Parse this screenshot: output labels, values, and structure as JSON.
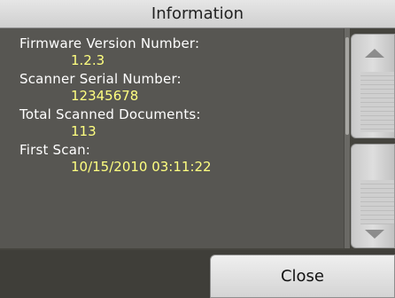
{
  "title": "Information",
  "fields": [
    {
      "label": "Firmware Version Number:",
      "value": "1.2.3"
    },
    {
      "label": "Scanner Serial Number:",
      "value": "12345678"
    },
    {
      "label": "Total Scanned Documents:",
      "value": "113"
    },
    {
      "label": "First Scan:",
      "value": "10/15/2010 03:11:22"
    }
  ],
  "buttons": {
    "close_label": "Close"
  },
  "icons": {
    "scroll_up": "arrow-up-icon",
    "scroll_down": "arrow-down-icon"
  },
  "colors": {
    "value_text": "#ffff80",
    "label_text": "#ffffff"
  }
}
